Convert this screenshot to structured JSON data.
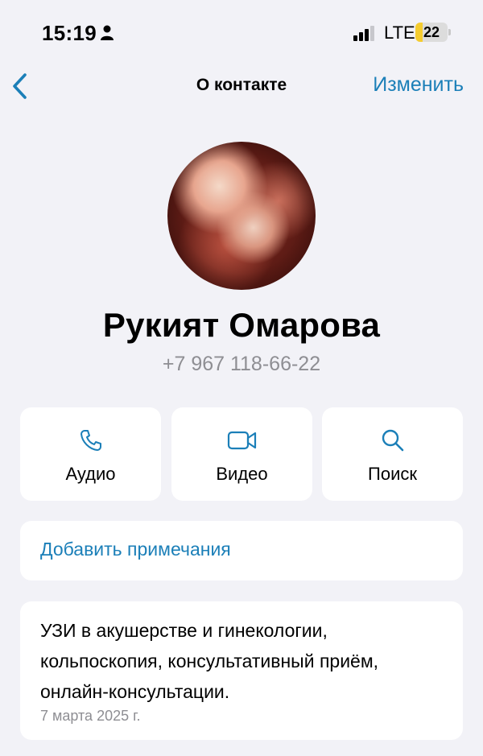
{
  "status_bar": {
    "time": "15:19",
    "network": "LTE",
    "battery_level": "22",
    "battery_fraction": 0.22,
    "battery_color": "#f5cc2f",
    "icons": [
      "person-icon",
      "signal-icon",
      "battery-icon"
    ]
  },
  "nav": {
    "back_icon": "chevron-left-icon",
    "title": "О контакте",
    "edit_label": "Изменить",
    "accent": "#1b7fb8"
  },
  "contact": {
    "name": "Рукият Омарова",
    "phone": "+7 967 118-66-22"
  },
  "actions": [
    {
      "label": "Аудио",
      "icon": "phone-icon"
    },
    {
      "label": "Видео",
      "icon": "video-camera-icon"
    },
    {
      "label": "Поиск",
      "icon": "search-icon"
    }
  ],
  "notes": {
    "label": "Добавить примечания"
  },
  "bio": {
    "text": "УЗИ в акушерстве и гинекологии, кольпоскопия, консультативный приём, онлайн-консультации.",
    "date": "7 марта 2025 г."
  }
}
